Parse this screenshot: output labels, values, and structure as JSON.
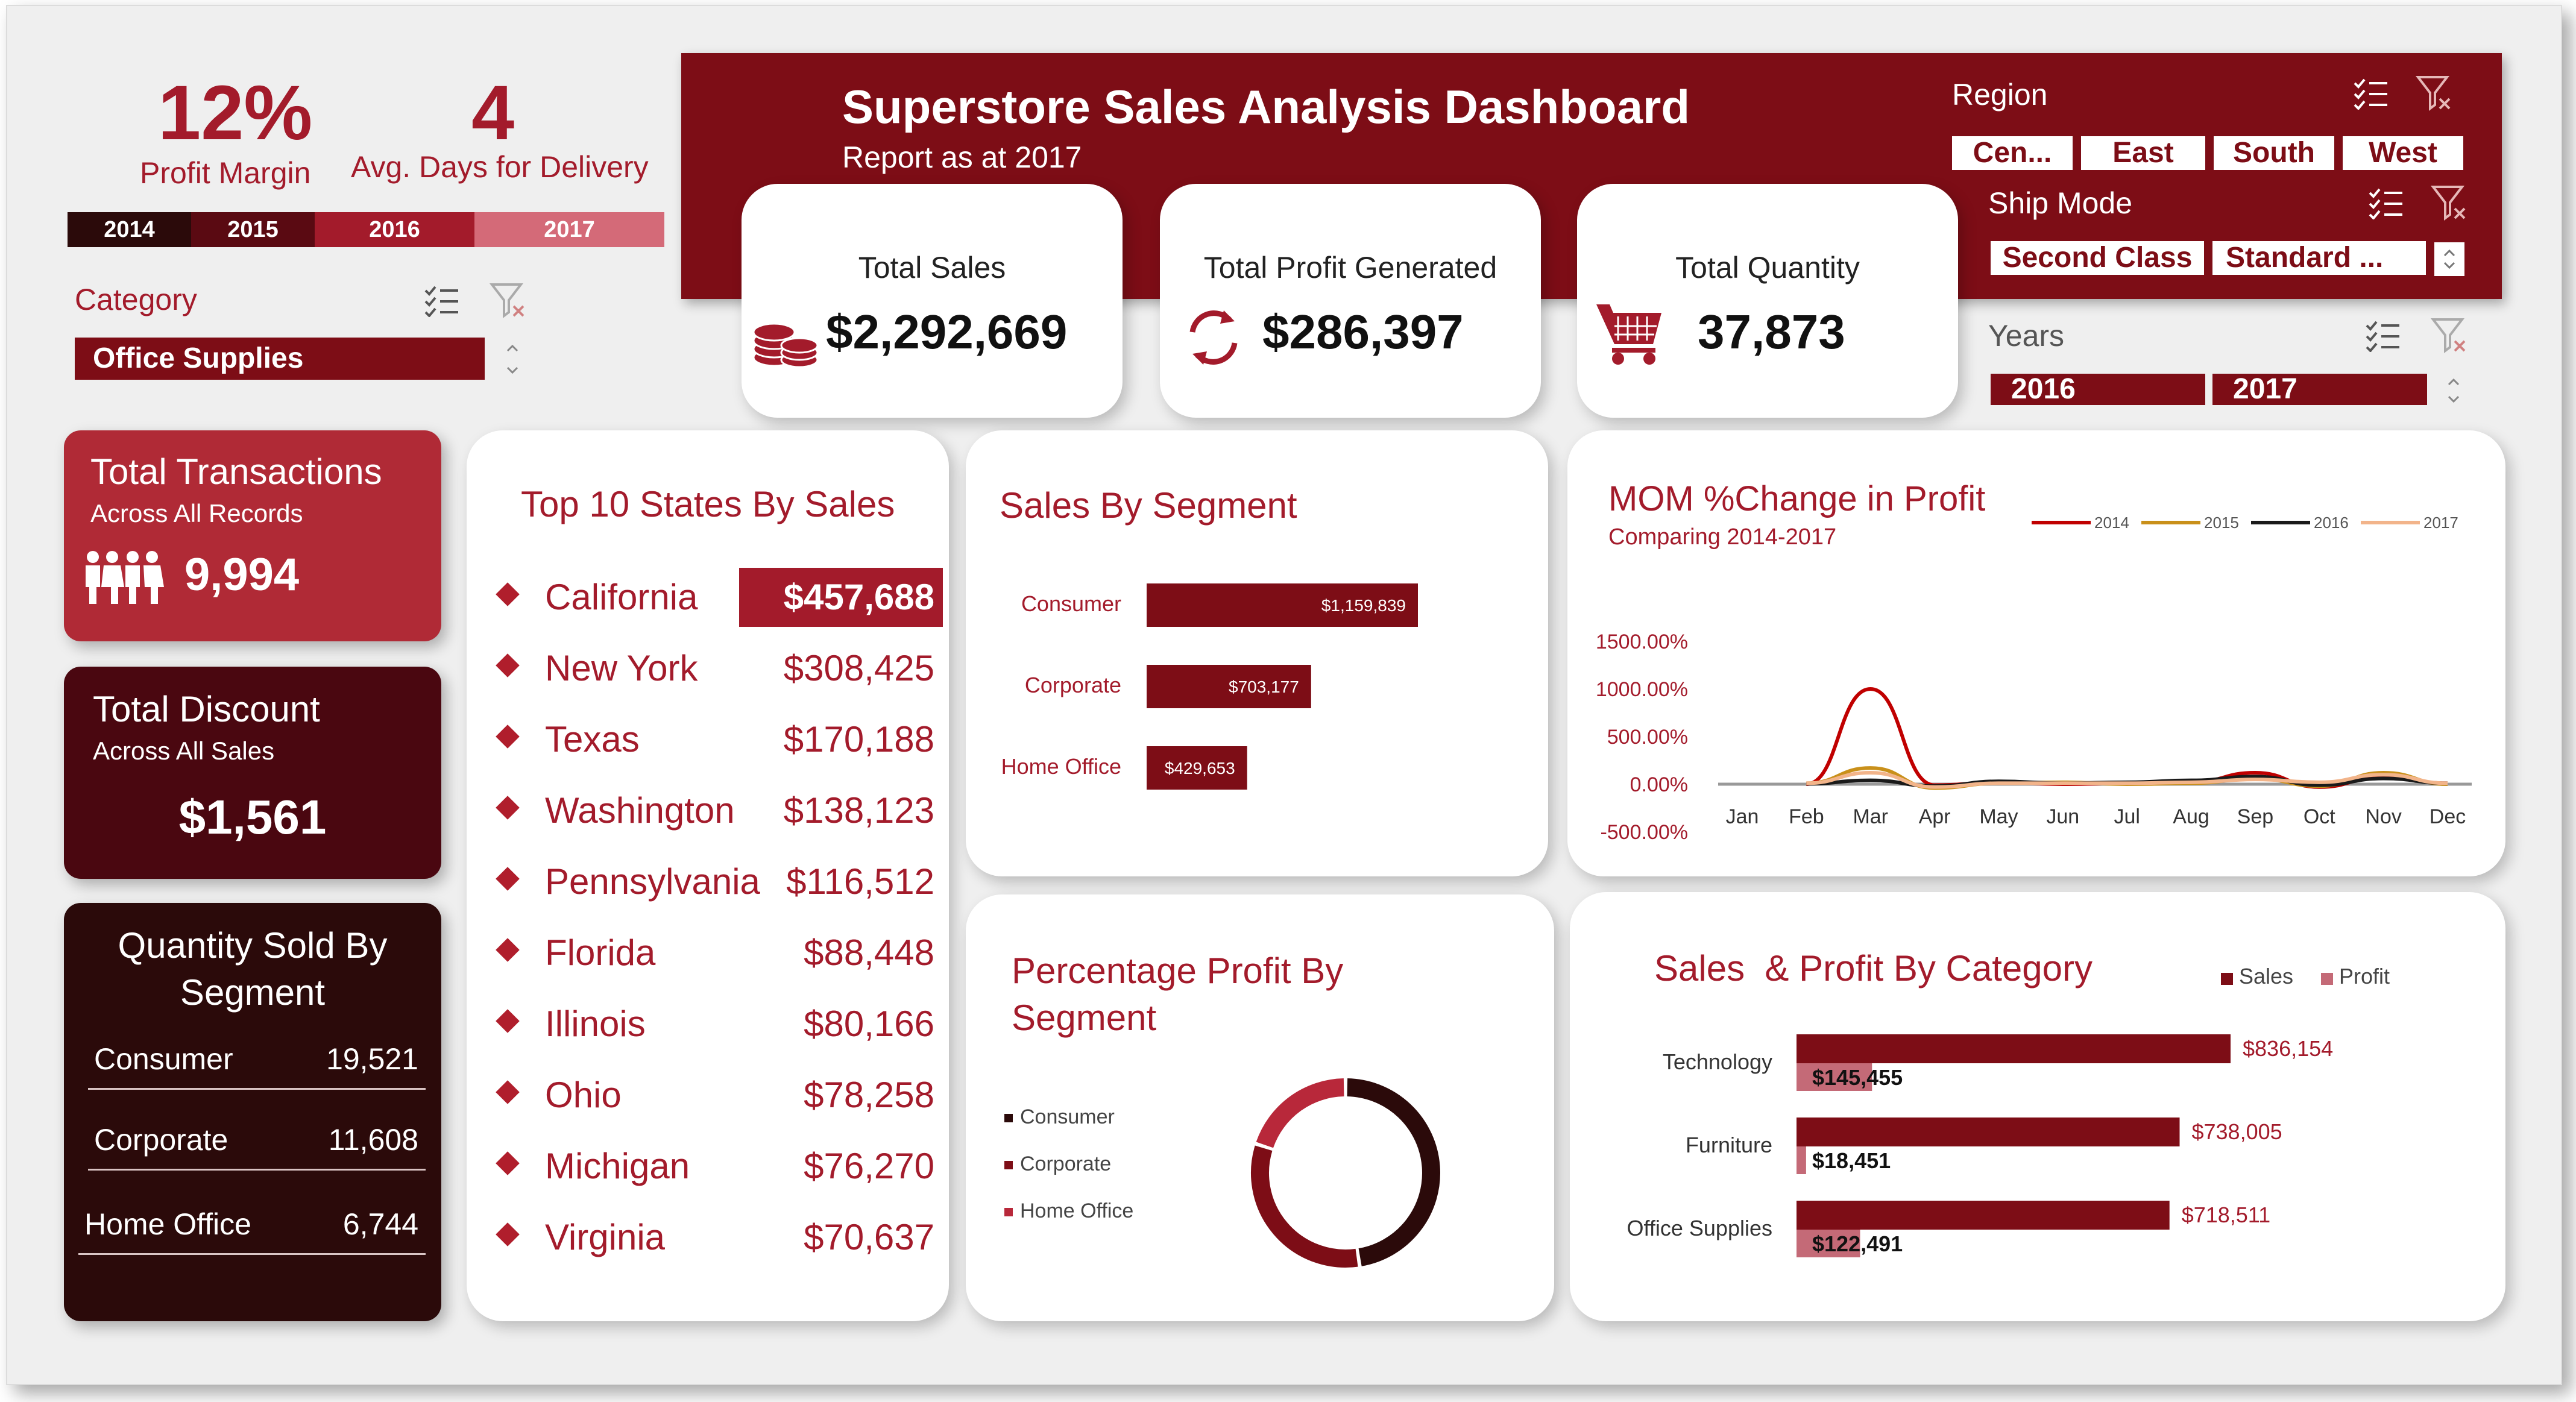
{
  "kpi_top": {
    "profit_margin_value": "12%",
    "profit_margin_label": "Profit Margin",
    "delivery_value": "4",
    "delivery_label": "Avg. Days for Delivery"
  },
  "year_chips": [
    "2014",
    "2015",
    "2016",
    "2017"
  ],
  "category_slicer": {
    "label": "Category",
    "selected": "Office Supplies"
  },
  "header": {
    "title": "Superstore Sales Analysis Dashboard",
    "subtitle": "Report as at  2017"
  },
  "region_slicer": {
    "label": "Region",
    "options": [
      "Cen...",
      "East",
      "South",
      "West"
    ]
  },
  "shipmode_slicer": {
    "label": "Ship Mode",
    "options": [
      "Second Class",
      "Standard ..."
    ]
  },
  "years_slicer": {
    "label": "Years",
    "options": [
      "2016",
      "2017"
    ]
  },
  "totals": {
    "sales_label": "Total Sales",
    "sales_value": "$2,292,669",
    "profit_label": "Total Profit Generated",
    "profit_value": "$286,397",
    "quantity_label": "Total Quantity",
    "quantity_value": "37,873"
  },
  "transactions": {
    "title": "Total Transactions",
    "sub": "Across All Records",
    "value": "9,994"
  },
  "discount": {
    "title": "Total Discount",
    "sub": "Across All Sales",
    "value": "$1,561"
  },
  "qty_segment": {
    "title_line1": "Quantity Sold By",
    "title_line2": "Segment",
    "rows": [
      {
        "name": "Consumer",
        "value": "19,521"
      },
      {
        "name": "Corporate",
        "value": "11,608"
      },
      {
        "name": "Home Office",
        "value": "6,744"
      }
    ]
  },
  "top_states": {
    "title": "Top 10 States By Sales",
    "rows": [
      {
        "state": "California",
        "sales": "$457,688"
      },
      {
        "state": "New York",
        "sales": "$308,425"
      },
      {
        "state": "Texas",
        "sales": "$170,188"
      },
      {
        "state": "Washington",
        "sales": "$138,123"
      },
      {
        "state": "Pennsylvania",
        "sales": "$116,512"
      },
      {
        "state": "Florida",
        "sales": "$88,448"
      },
      {
        "state": "Illinois",
        "sales": "$80,166"
      },
      {
        "state": "Ohio",
        "sales": "$78,258"
      },
      {
        "state": "Michigan",
        "sales": "$76,270"
      },
      {
        "state": "Virginia",
        "sales": "$70,637"
      }
    ]
  },
  "chart_data": [
    {
      "type": "bar",
      "title": "Sales By Segment",
      "orientation": "horizontal",
      "categories": [
        "Consumer",
        "Corporate",
        "Home Office"
      ],
      "values": [
        1159839,
        703177,
        429653
      ],
      "labels": [
        "$1,159,839",
        "$703,177",
        "$429,653"
      ],
      "color": "#7d0d16"
    },
    {
      "type": "line",
      "title": "MOM %Change in Profit",
      "subtitle": "Comparing 2014-2017",
      "x": [
        "Jan",
        "Feb",
        "Mar",
        "Apr",
        "May",
        "Jun",
        "Jul",
        "Aug",
        "Sep",
        "Oct",
        "Nov",
        "Dec"
      ],
      "y_ticks": [
        "1500.00%",
        "1000.00%",
        "500.00%",
        "0.00%",
        "-500.00%"
      ],
      "ylim": [
        -500,
        1500
      ],
      "series": [
        {
          "name": "2014",
          "color": "#c00000",
          "values": [
            null,
            0,
            1000,
            -10,
            20,
            0,
            10,
            20,
            120,
            -30,
            80,
            10
          ]
        },
        {
          "name": "2015",
          "color": "#c9901a",
          "values": [
            null,
            10,
            170,
            -40,
            10,
            20,
            0,
            10,
            60,
            -20,
            120,
            0
          ]
        },
        {
          "name": "2016",
          "color": "#1a1a1a",
          "values": [
            null,
            5,
            40,
            -20,
            30,
            10,
            20,
            40,
            80,
            -10,
            60,
            10
          ]
        },
        {
          "name": "2017",
          "color": "#f2b48a",
          "values": [
            null,
            10,
            120,
            -30,
            10,
            10,
            10,
            20,
            50,
            20,
            100,
            10
          ]
        }
      ]
    },
    {
      "type": "pie",
      "title_line1": "Percentage Profit By",
      "title_line2": "Segment",
      "categories": [
        "Consumer",
        "Corporate",
        "Home Office"
      ],
      "values": [
        47.6,
        32.4,
        20.0
      ],
      "colors": [
        "#2b0a0a",
        "#7d0d16",
        "#b8283a"
      ]
    },
    {
      "type": "bar",
      "title": "Sales  & Profit By Category",
      "orientation": "horizontal",
      "categories": [
        "Technology",
        "Furniture",
        "Office Supplies"
      ],
      "series": [
        {
          "name": "Sales",
          "color": "#7d0d16",
          "values": [
            836154,
            738005,
            718511
          ],
          "labels": [
            "$836,154",
            "$738,005",
            "$718,511"
          ]
        },
        {
          "name": "Profit",
          "color": "#c46a77",
          "values": [
            145455,
            18451,
            122491
          ],
          "labels": [
            "$145,455",
            "$18,451",
            "$122,491"
          ]
        }
      ]
    }
  ]
}
